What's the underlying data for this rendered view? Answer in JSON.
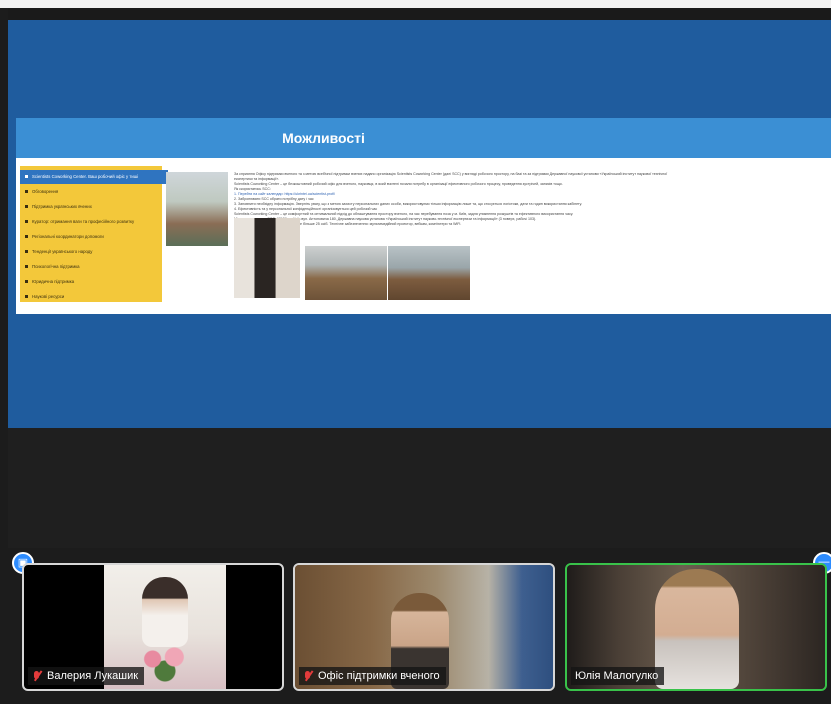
{
  "slide": {
    "title": "Можливості",
    "menu": [
      "Scientists Coworking Center. Ваш робочий офіс у тиші",
      "Обговорення",
      "Підтримка українських вчених",
      "Куратор: отримання ваги та професійного розвитку",
      "Регіональні координатори допомоги",
      "Тенденції українського народу",
      "Психологічна підтримка",
      "Юридична підтримка",
      "Наукові ресурси"
    ],
    "text_lines": [
      "За сприяння Офісу підтримки вченого та з метою всебічної підтримки вчених надано організацію Scientists Coworking Center (далі SCC) у вигляді робочого простору, на базі та за підтримки Державної наукової установи «Український інститут наукової технічної",
      "експертизи та інформації».",
      "Scientists Coworking Center – це безкоштовний робочий офіс для вченого, науковця, в який вчителі почали потребу в організації ефективного робочого процесу, проведення зустрічей, записів тощо.",
      "Як скористатись SCC:",
      "1. Перейти на сайт календар: https://ukrintei.ua/scientist-profi/",
      "2. Забронювати SCC обрати потрібну дату і час",
      "3. Заповнити необхідну інформацію. Зверніть увагу, що з метою захисту персональних даних особи, використовуємо тільки інформацію лише та, що стосується логістики, дати та годин використання кабінету.",
      "4. Ефективність та у персональної конфіденційності організовується цей робочий час",
      "Scientists Coworking Center – це комфортний та оптимальний підхід до облаштування простору вченого, на час перебування поза у м. Київ, задля уникнення розкуштів та ефективного використання часу.",
      "Місце знаходження SCC: 03150, м. Київ вул. Антоновича 180, Державна наукова установа «Український інститут науково-технічної експертизи та інформації» (3 поверх, рабочі 103).",
      "Одночасно у SCC можуть перебувати не більше 25 осіб. Технічне забезпечення: мультимедійний проектор, вебкам, комп'ютери та WiFi."
    ]
  },
  "participants": [
    {
      "name": "Валерия Лукашик",
      "muted": true
    },
    {
      "name": "Офіс підтримки вченого",
      "muted": true
    },
    {
      "name": "Юлія Малогулко",
      "muted": false
    }
  ],
  "colors": {
    "share_background": "#1f5c9e",
    "slide_header": "#3b8fd4",
    "menu_background": "#f3c83a",
    "menu_active": "#2f74c0",
    "active_speaker_border": "#39c24a",
    "muted_icon": "#e23b3b"
  },
  "icons": {
    "share_badge": "screen-share-icon",
    "more_badge": "more-icon",
    "mute": "muted-microphone-icon"
  }
}
